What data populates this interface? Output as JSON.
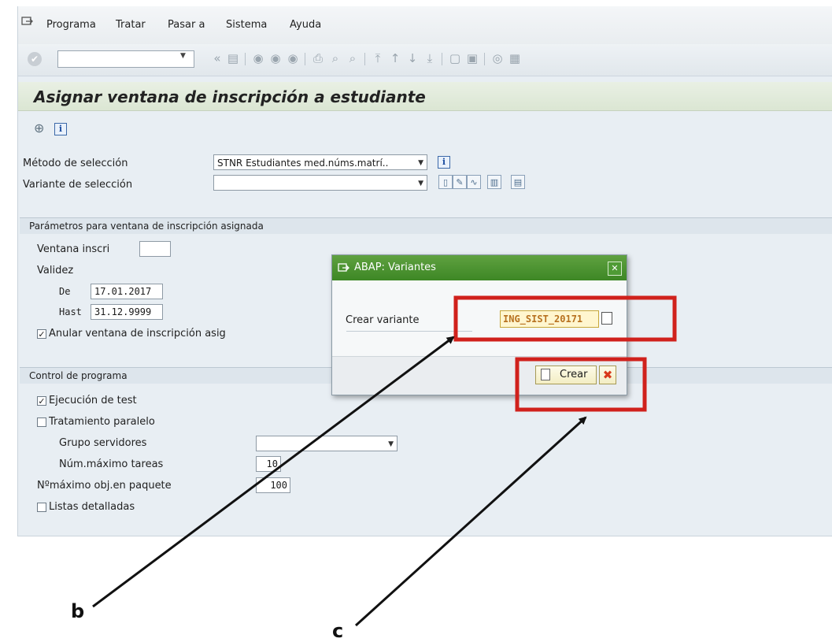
{
  "menu": {
    "items": [
      {
        "label": "Programa"
      },
      {
        "label": "Tratar"
      },
      {
        "label": "Pasar a"
      },
      {
        "label": "Sistema"
      },
      {
        "label": "Ayuda"
      }
    ]
  },
  "toolbar": {
    "command_value": ""
  },
  "page": {
    "title": "Asignar ventana de inscripción a estudiante"
  },
  "selection": {
    "method_label": "Método de selección",
    "method_value": "STNR Estudiantes med.núms.matrí..",
    "variant_label": "Variante de selección",
    "variant_value": ""
  },
  "params_group": {
    "heading": "Parámetros para ventana de inscripción asignada",
    "window_label": "Ventana inscri",
    "window_value": "",
    "validity_label": "Validez",
    "from_label": "De",
    "from_value": "17.01.2017",
    "to_label": "Hast",
    "to_value": "31.12.9999",
    "override_label": "Anular ventana de inscripción asig",
    "override_checked": true
  },
  "control_group": {
    "heading": "Control de programa",
    "test_run_label": "Ejecución de test",
    "test_run_checked": true,
    "parallel_label": "Tratamiento paralelo",
    "parallel_checked": false,
    "server_group_label": "Grupo servidores",
    "server_group_value": "",
    "max_tasks_label": "Núm.máximo tareas",
    "max_tasks_value": "10",
    "max_objects_label": "Nºmáximo obj.en paquete",
    "max_objects_value": "100",
    "detailed_lists_label": "Listas detalladas",
    "detailed_lists_checked": false
  },
  "dialog": {
    "title": "ABAP: Variantes",
    "create_variant_label": "Crear variante",
    "variant_name_value": "ING_SIST_20171",
    "create_button_label": "Crear"
  },
  "annotations": {
    "label_b": "b",
    "label_c": "c",
    "highlight_color": "#d0211c",
    "arrow_color": "#111111"
  }
}
